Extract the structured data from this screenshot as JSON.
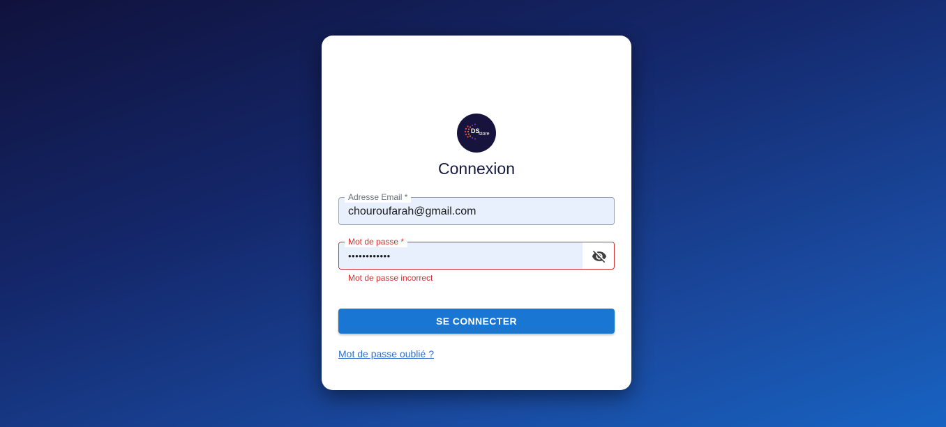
{
  "login": {
    "title": "Connexion",
    "logo": {
      "text_main": "DS",
      "text_sub": "store",
      "background_color": "#16133d"
    },
    "email_field": {
      "label": "Adresse Email  *",
      "value": "chouroufarah@gmail.com"
    },
    "password_field": {
      "label": "Mot de passe *",
      "value": "••••••••••••",
      "toggle_icon": "eye-off-icon",
      "error_message": "Mot de passe incorrect"
    },
    "submit_label": "SE CONNECTER",
    "forgot_link": "Mot de passe oublié ?"
  },
  "colors": {
    "primary": "#1976d2",
    "error": "#d32f2f",
    "input_fill": "#e8f0fe",
    "title_text": "#141a3f"
  }
}
